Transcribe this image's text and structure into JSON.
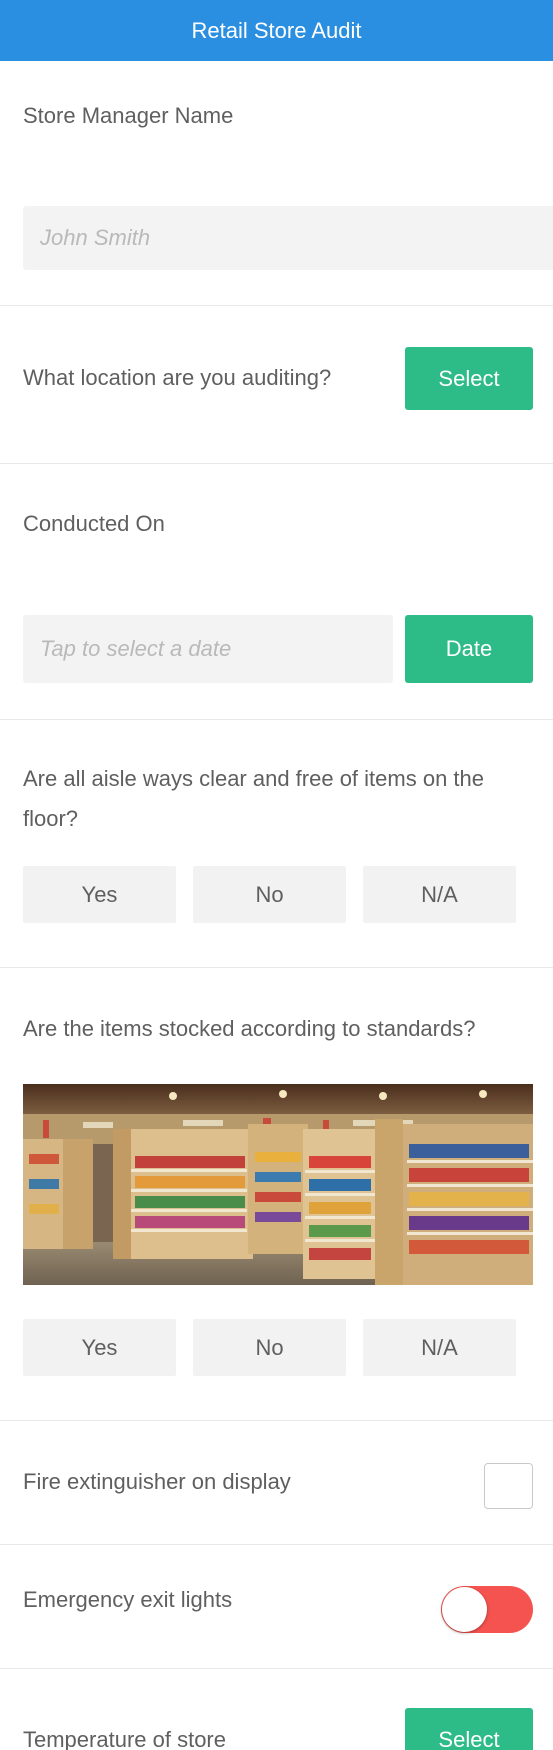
{
  "header": {
    "title": "Retail Store Audit"
  },
  "manager": {
    "label": "Store Manager Name",
    "placeholder": "John Smith"
  },
  "location": {
    "label": "What location are you auditing?",
    "button": "Select"
  },
  "conducted": {
    "label": "Conducted On",
    "placeholder": "Tap to select a date",
    "button": "Date"
  },
  "aisle": {
    "label": "Are all aisle ways clear and free of items on the floor?",
    "options": [
      "Yes",
      "No",
      "N/A"
    ]
  },
  "stocked": {
    "label": "Are the items stocked according to standards?",
    "options": [
      "Yes",
      "No",
      "N/A"
    ]
  },
  "fire": {
    "label": "Fire extinguisher on display",
    "checked": false
  },
  "exit_lights": {
    "label": "Emergency exit lights",
    "toggle_on": false
  },
  "temperature": {
    "label": "Temperature of store",
    "button": "Select"
  },
  "colors": {
    "header": "#2a8fe0",
    "accent_green": "#2dbb87",
    "toggle_off_red": "#f5534f",
    "field_bg": "#f3f3f3"
  }
}
